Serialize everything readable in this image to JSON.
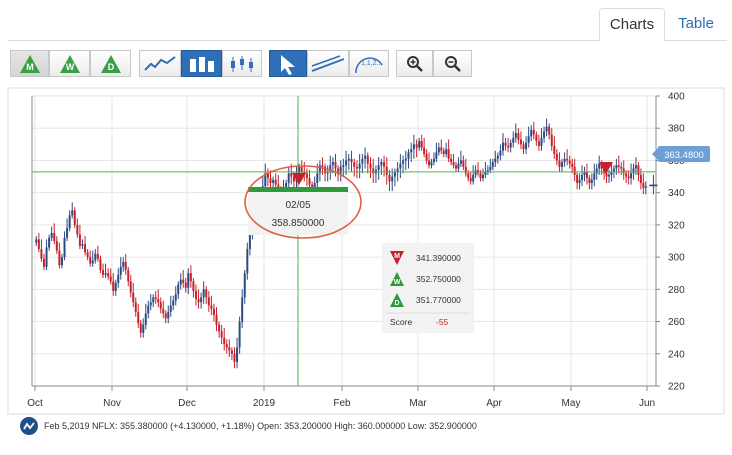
{
  "tabs": {
    "charts": "Charts",
    "table": "Table"
  },
  "toolbar": {
    "buttons": [
      {
        "label": "M"
      },
      {
        "label": "W"
      },
      {
        "label": "D"
      },
      {
        "label": "line"
      },
      {
        "label": "bar"
      },
      {
        "label": "candle"
      },
      {
        "label": "pointer"
      },
      {
        "label": "trendline"
      },
      {
        "label": "1,1,2..."
      },
      {
        "label": "zoom-in"
      },
      {
        "label": "zoom-out"
      }
    ]
  },
  "chart_data": {
    "type": "candlestick",
    "ylim": [
      220,
      400
    ],
    "yticks": [
      220,
      240,
      260,
      280,
      300,
      320,
      340,
      360,
      380,
      400
    ],
    "xticks": [
      "Oct",
      "Nov",
      "Dec",
      "2019",
      "Feb",
      "Mar",
      "Apr",
      "May",
      "Jun"
    ],
    "last_price_label": "363.4800",
    "crosshair": {
      "date": "02/05",
      "value": "358.850000",
      "y_value": 352.9
    },
    "colors": {
      "up": "#2b4a85",
      "down": "#c8202a",
      "grid": "#e6e6e6",
      "crosshair": "#55b24a",
      "last_badge": "#6d9fd4"
    },
    "series": [
      {
        "name": "Oct",
        "closes": [
          311,
          305,
          299,
          294,
          306,
          312,
          315,
          310,
          304,
          295,
          300,
          312,
          318,
          326,
          329,
          320,
          314,
          307,
          308,
          303,
          300,
          296,
          298,
          302,
          299,
          292,
          289,
          290,
          288,
          285
        ]
      },
      {
        "name": "Nov",
        "closes": [
          279,
          284,
          289,
          294,
          297,
          292,
          285,
          278,
          272,
          266,
          259,
          253,
          258,
          265,
          270,
          272,
          275,
          274,
          272,
          268,
          265,
          262,
          266,
          270,
          273,
          277,
          283,
          286,
          284,
          281
        ]
      },
      {
        "name": "Dec",
        "closes": [
          290,
          285,
          279,
          274,
          272,
          275,
          280,
          275,
          270,
          268,
          264,
          258,
          254,
          250,
          246,
          244,
          242,
          240,
          235,
          244,
          260,
          275,
          290,
          305,
          315,
          318,
          325,
          332,
          337,
          344
        ]
      },
      {
        "name": "Jan",
        "closes": [
          352,
          349,
          346,
          348,
          345,
          341,
          340,
          343,
          346,
          352,
          350,
          347,
          351,
          356,
          353,
          352,
          349,
          345,
          342,
          346,
          352,
          357,
          356,
          352,
          353,
          357,
          359,
          355,
          352,
          356
        ]
      },
      {
        "name": "Feb",
        "closes": [
          357,
          360,
          361,
          359,
          356,
          355,
          358,
          361,
          363,
          358,
          355,
          352,
          354,
          357,
          359,
          356,
          351,
          347,
          350,
          353,
          355,
          358,
          360,
          361,
          365,
          367,
          370,
          368
        ]
      },
      {
        "name": "Mar",
        "closes": [
          372,
          368,
          364,
          360,
          357,
          359,
          361,
          365,
          368,
          366,
          364,
          367,
          361,
          359,
          357,
          355,
          358,
          360,
          356,
          352,
          349,
          347,
          351,
          354,
          352,
          349,
          351,
          353,
          354,
          356,
          359
        ]
      },
      {
        "name": "Apr",
        "closes": [
          361,
          363,
          366,
          371,
          369,
          368,
          371,
          374,
          377,
          373,
          370,
          367,
          371,
          375,
          379,
          376,
          372,
          369,
          374,
          378,
          381,
          376,
          369,
          364,
          360,
          356,
          359,
          361,
          360,
          358
        ]
      },
      {
        "name": "May",
        "closes": [
          356,
          351,
          346,
          348,
          351,
          353,
          349,
          346,
          348,
          352,
          355,
          358,
          355,
          352,
          350,
          351,
          353,
          355,
          357,
          356,
          355,
          352,
          350,
          349,
          352,
          355,
          357,
          351,
          346,
          343,
          344
        ]
      },
      {
        "name": "Jun",
        "closes": [
          345,
          348,
          352,
          356,
          360,
          363.48
        ]
      }
    ],
    "score_box": {
      "rows": [
        {
          "tag": "M",
          "value": "341.390000",
          "color": "#c8202a",
          "dir": "down"
        },
        {
          "tag": "W",
          "value": "352.750000",
          "color": "#2e9a3c",
          "dir": "up"
        },
        {
          "tag": "D",
          "value": "351.770000",
          "color": "#2e9a3c",
          "dir": "up"
        }
      ],
      "score_label": "Score",
      "score_value": "-55"
    }
  },
  "status": {
    "text": "Feb 5,2019 NFLX: 355.380000 (+4.130000, +1.18%) Open: 353.200000 High: 360.000000 Low: 352.900000"
  }
}
